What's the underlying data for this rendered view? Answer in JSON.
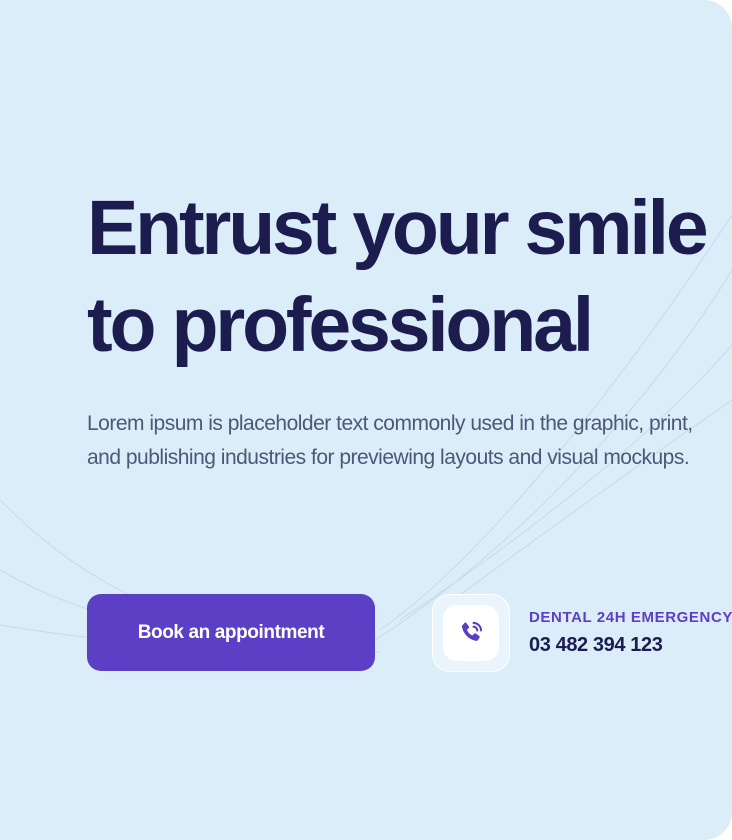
{
  "hero": {
    "headline_line1": "Entrust your smile",
    "headline_line2": "to professional",
    "description": "Lorem ipsum is placeholder text commonly used in the graphic, print, and publishing industries for previewing layouts and visual mockups.",
    "cta_label": "Book an appointment"
  },
  "emergency": {
    "label": "DENTAL 24H EMERGENCY",
    "phone": "03 482 394 123",
    "icon": "phone-ringing-icon"
  },
  "colors": {
    "background": "#daedf9",
    "heading": "#1c1c4f",
    "body_text": "#4c5876",
    "accent": "#5b3fc4",
    "button_text": "#ffffff"
  }
}
